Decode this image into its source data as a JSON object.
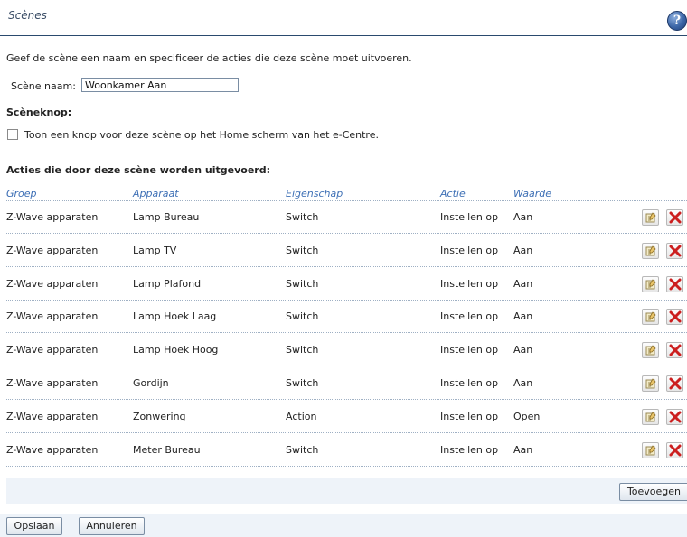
{
  "header": {
    "title": "Scènes",
    "help_icon": "help-icon"
  },
  "intro": "Geef de scène een naam en specificeer de acties die deze scène moet uitvoeren.",
  "scene_name": {
    "label": "Scène naam:",
    "value": "Woonkamer Aan"
  },
  "scene_button": {
    "title": "Scèneknop:",
    "checkbox_label": "Toon een knop voor deze scène op het Home scherm van het e-Centre.",
    "checked": false
  },
  "actions": {
    "title": "Acties die door deze scène worden uitgevoerd:",
    "columns": [
      "Groep",
      "Apparaat",
      "Eigenschap",
      "Actie",
      "Waarde"
    ],
    "rows": [
      {
        "group": "Z-Wave apparaten",
        "device": "Lamp Bureau",
        "property": "Switch",
        "action": "Instellen op",
        "value": "Aan"
      },
      {
        "group": "Z-Wave apparaten",
        "device": "Lamp TV",
        "property": "Switch",
        "action": "Instellen op",
        "value": "Aan"
      },
      {
        "group": "Z-Wave apparaten",
        "device": "Lamp Plafond",
        "property": "Switch",
        "action": "Instellen op",
        "value": "Aan"
      },
      {
        "group": "Z-Wave apparaten",
        "device": "Lamp Hoek Laag",
        "property": "Switch",
        "action": "Instellen op",
        "value": "Aan"
      },
      {
        "group": "Z-Wave apparaten",
        "device": "Lamp Hoek Hoog",
        "property": "Switch",
        "action": "Instellen op",
        "value": "Aan"
      },
      {
        "group": "Z-Wave apparaten",
        "device": "Gordijn",
        "property": "Switch",
        "action": "Instellen op",
        "value": "Aan"
      },
      {
        "group": "Z-Wave apparaten",
        "device": "Zonwering",
        "property": "Action",
        "action": "Instellen op",
        "value": "Open"
      },
      {
        "group": "Z-Wave apparaten",
        "device": "Meter Bureau",
        "property": "Switch",
        "action": "Instellen op",
        "value": "Aan"
      }
    ],
    "row_icons": {
      "edit": "edit-icon",
      "delete": "delete-icon"
    },
    "add_label": "Toevoegen"
  },
  "footer": {
    "save_label": "Opslaan",
    "cancel_label": "Annuleren"
  },
  "colors": {
    "header_link": "#3d6fb5",
    "delete_red": "#cc1f1f",
    "panel_bg": "#eef3f9"
  }
}
